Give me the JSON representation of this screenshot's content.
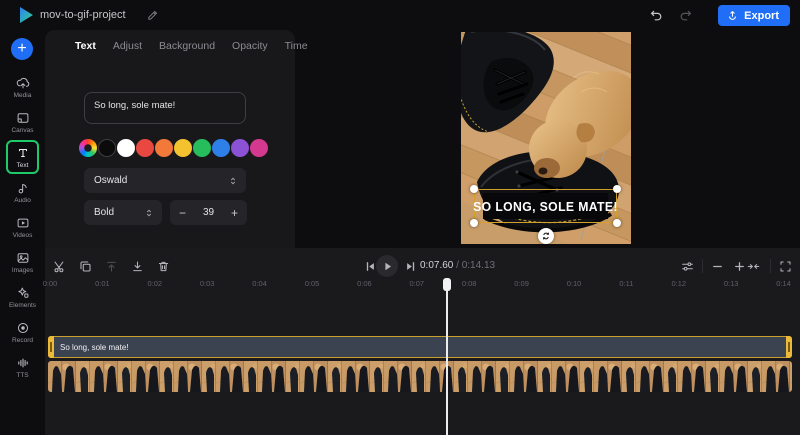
{
  "header": {
    "project_name": "mov-to-gif-project",
    "export_label": "Export",
    "accent_blue": "#1f6ef5"
  },
  "sidebar": {
    "add_label": "+",
    "active_highlight": "#1ec969",
    "items": [
      {
        "label": "Media",
        "icon": "upload-media-icon"
      },
      {
        "label": "Canvas",
        "icon": "canvas-icon"
      },
      {
        "label": "Text",
        "icon": "text-icon",
        "active": true
      },
      {
        "label": "Audio",
        "icon": "audio-note-icon"
      },
      {
        "label": "Videos",
        "icon": "videos-icon"
      },
      {
        "label": "Images",
        "icon": "images-icon"
      },
      {
        "label": "Elements",
        "icon": "elements-icon"
      },
      {
        "label": "Record",
        "icon": "record-icon"
      },
      {
        "label": "TTS",
        "icon": "tts-icon"
      }
    ]
  },
  "text_panel": {
    "tabs": [
      {
        "label": "Text",
        "active": true
      },
      {
        "label": "Adjust"
      },
      {
        "label": "Background"
      },
      {
        "label": "Opacity"
      },
      {
        "label": "Time"
      }
    ],
    "text_value": "So long, sole mate!",
    "color_swatches": [
      "color-wheel",
      "#0b0b0b",
      "#ffffff",
      "#e8483f",
      "#f2793a",
      "#f3c22e",
      "#27bd5c",
      "#2f7fe8",
      "#8b52d6",
      "#d5388f"
    ],
    "font_family": "Oswald",
    "font_weight": "Bold",
    "font_size": "39",
    "decrease_label": "−",
    "increase_label": "+"
  },
  "preview": {
    "overlay_text": "SO LONG, SOLE MATE!"
  },
  "timeline": {
    "current_time": "0:07.60",
    "separator": "/",
    "total_time": "0:14.13",
    "ruler_labels": [
      "0:00",
      "0:01",
      "0:02",
      "0:03",
      "0:04",
      "0:05",
      "0:06",
      "0:07",
      "0:08",
      "0:09",
      "0:10",
      "0:11",
      "0:12",
      "0:13",
      "0:14"
    ],
    "text_clip_label": "So long, sole mate!",
    "tools_left": [
      {
        "name": "split-clip-button",
        "icon": "split-scissors-icon"
      },
      {
        "name": "duplicate-clip-button",
        "icon": "duplicate-icon"
      },
      {
        "name": "move-track-up-button",
        "icon": "move-up-icon",
        "disabled": true
      },
      {
        "name": "move-track-down-button",
        "icon": "move-down-icon"
      },
      {
        "name": "delete-clip-button",
        "icon": "delete-trash-icon"
      }
    ],
    "transport": [
      {
        "name": "skip-previous-button",
        "icon": "skip-previous-icon"
      },
      {
        "name": "play-button",
        "icon": "play-icon"
      },
      {
        "name": "skip-next-button",
        "icon": "skip-next-icon"
      }
    ],
    "tools_right": [
      {
        "name": "timeline-settings-button",
        "icon": "timeline-settings-icon"
      },
      {
        "name": "zoom-out-button",
        "icon": "zoom-out-icon"
      },
      {
        "name": "zoom-in-button",
        "icon": "zoom-in-icon"
      },
      {
        "name": "zoom-fit-button",
        "icon": "zoom-fit-icon"
      },
      {
        "name": "fullscreen-button",
        "icon": "fullscreen-icon"
      }
    ]
  }
}
